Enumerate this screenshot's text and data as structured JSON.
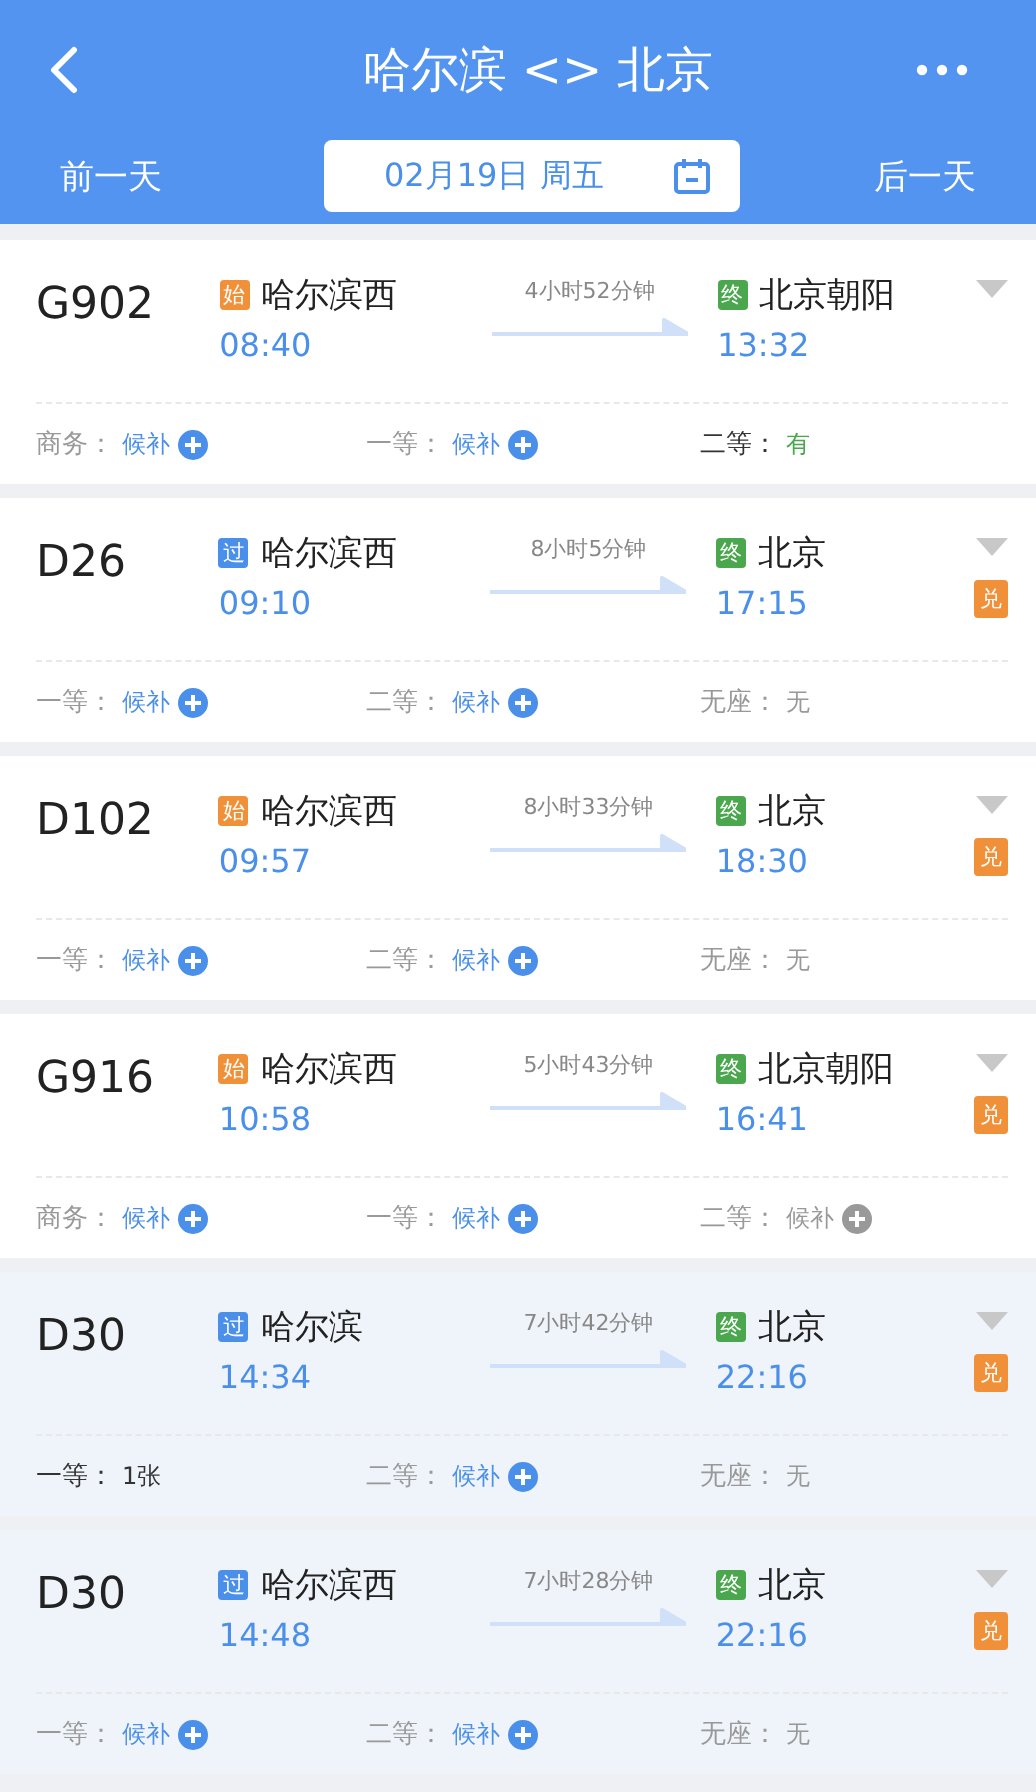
{
  "header": {
    "title": "哈尔滨 <> 北京",
    "prev_day": "前一天",
    "date": "02月19日 周五",
    "next_day": "后一天"
  },
  "trains": [
    {
      "number": "G902",
      "dimmed": false,
      "from_tag": {
        "text": "始",
        "kind": "start"
      },
      "from": "哈尔滨西",
      "depart": "08:40",
      "duration": "4小时52分钟",
      "to_tag": {
        "text": "终",
        "kind": "end"
      },
      "to": "北京朝阳",
      "arrive": "13:32",
      "seats": [
        {
          "label": "商务：",
          "value": "候补",
          "kind": "waitlist"
        },
        {
          "label": "一等：",
          "value": "候补",
          "kind": "waitlist"
        },
        {
          "label": "二等：",
          "value": "有",
          "kind": "available"
        }
      ]
    },
    {
      "number": "D26",
      "dimmed": false,
      "from_tag": {
        "text": "过",
        "kind": "pass"
      },
      "from": "哈尔滨西",
      "depart": "09:10",
      "duration": "8小时5分钟",
      "to_tag": {
        "text": "终",
        "kind": "end"
      },
      "to": "北京",
      "arrive": "17:15",
      "badge": "兑",
      "seats": [
        {
          "label": "一等：",
          "value": "候补",
          "kind": "waitlist"
        },
        {
          "label": "二等：",
          "value": "候补",
          "kind": "waitlist"
        },
        {
          "label": "无座：",
          "value": "无",
          "kind": "none"
        }
      ]
    },
    {
      "number": "D102",
      "dimmed": false,
      "from_tag": {
        "text": "始",
        "kind": "start"
      },
      "from": "哈尔滨西",
      "depart": "09:57",
      "duration": "8小时33分钟",
      "to_tag": {
        "text": "终",
        "kind": "end"
      },
      "to": "北京",
      "arrive": "18:30",
      "badge": "兑",
      "seats": [
        {
          "label": "一等：",
          "value": "候补",
          "kind": "waitlist"
        },
        {
          "label": "二等：",
          "value": "候补",
          "kind": "waitlist"
        },
        {
          "label": "无座：",
          "value": "无",
          "kind": "none"
        }
      ]
    },
    {
      "number": "G916",
      "dimmed": false,
      "from_tag": {
        "text": "始",
        "kind": "start"
      },
      "from": "哈尔滨西",
      "depart": "10:58",
      "duration": "5小时43分钟",
      "to_tag": {
        "text": "终",
        "kind": "end"
      },
      "to": "北京朝阳",
      "arrive": "16:41",
      "badge": "兑",
      "seats": [
        {
          "label": "商务：",
          "value": "候补",
          "kind": "waitlist"
        },
        {
          "label": "一等：",
          "value": "候补",
          "kind": "waitlist"
        },
        {
          "label": "二等：",
          "value": "候补",
          "kind": "waitlist_closed"
        }
      ]
    },
    {
      "number": "D30",
      "dimmed": true,
      "from_tag": {
        "text": "过",
        "kind": "pass"
      },
      "from": "哈尔滨",
      "depart": "14:34",
      "duration": "7小时42分钟",
      "to_tag": {
        "text": "终",
        "kind": "end"
      },
      "to": "北京",
      "arrive": "22:16",
      "badge": "兑",
      "seats": [
        {
          "label": "一等：",
          "value": "1张",
          "kind": "count"
        },
        {
          "label": "二等：",
          "value": "候补",
          "kind": "waitlist"
        },
        {
          "label": "无座：",
          "value": "无",
          "kind": "none"
        }
      ]
    },
    {
      "number": "D30",
      "dimmed": true,
      "from_tag": {
        "text": "过",
        "kind": "pass"
      },
      "from": "哈尔滨西",
      "depart": "14:48",
      "duration": "7小时28分钟",
      "to_tag": {
        "text": "终",
        "kind": "end"
      },
      "to": "北京",
      "arrive": "22:16",
      "badge": "兑",
      "seats": [
        {
          "label": "一等：",
          "value": "候补",
          "kind": "waitlist"
        },
        {
          "label": "二等：",
          "value": "候补",
          "kind": "waitlist"
        },
        {
          "label": "无座：",
          "value": "无",
          "kind": "none"
        }
      ]
    }
  ]
}
